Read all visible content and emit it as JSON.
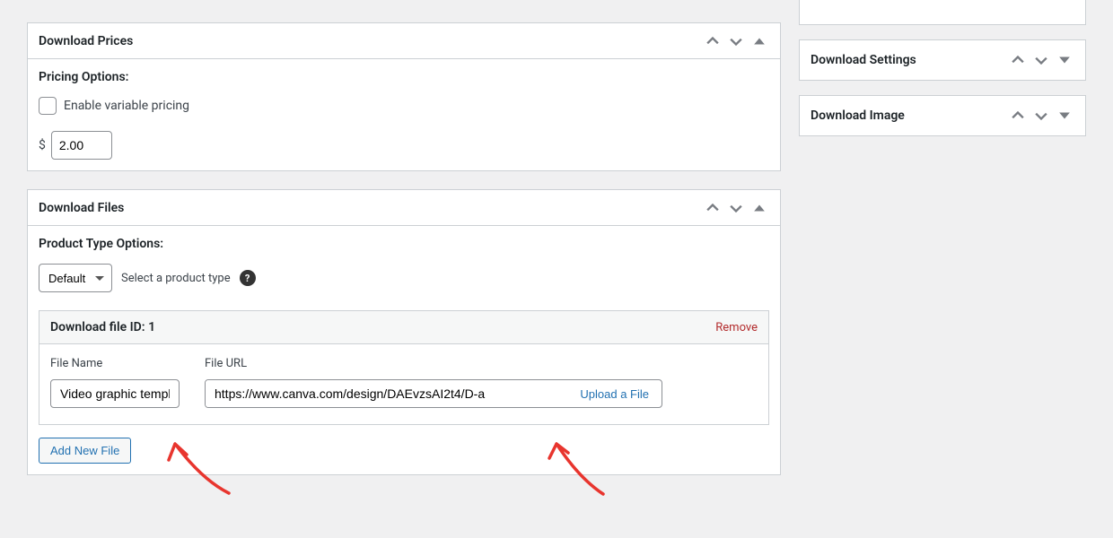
{
  "prices_panel": {
    "title": "Download Prices",
    "pricing_options_label": "Pricing Options:",
    "enable_variable_label": "Enable variable pricing",
    "currency_symbol": "$",
    "price_value": "2.00"
  },
  "files_panel": {
    "title": "Download Files",
    "product_type_label": "Product Type Options:",
    "product_type_selected": "Default",
    "product_type_desc": "Select a product type",
    "file_header": "Download file ID: 1",
    "remove_label": "Remove",
    "file_name_label": "File Name",
    "file_name_value": "Video graphic template",
    "file_url_label": "File URL",
    "file_url_value": "https://www.canva.com/design/DAEvzsAI2t4/D-a",
    "upload_label": "Upload a File",
    "add_new_label": "Add New File"
  },
  "sidebar": {
    "settings_title": "Download Settings",
    "image_title": "Download Image"
  }
}
